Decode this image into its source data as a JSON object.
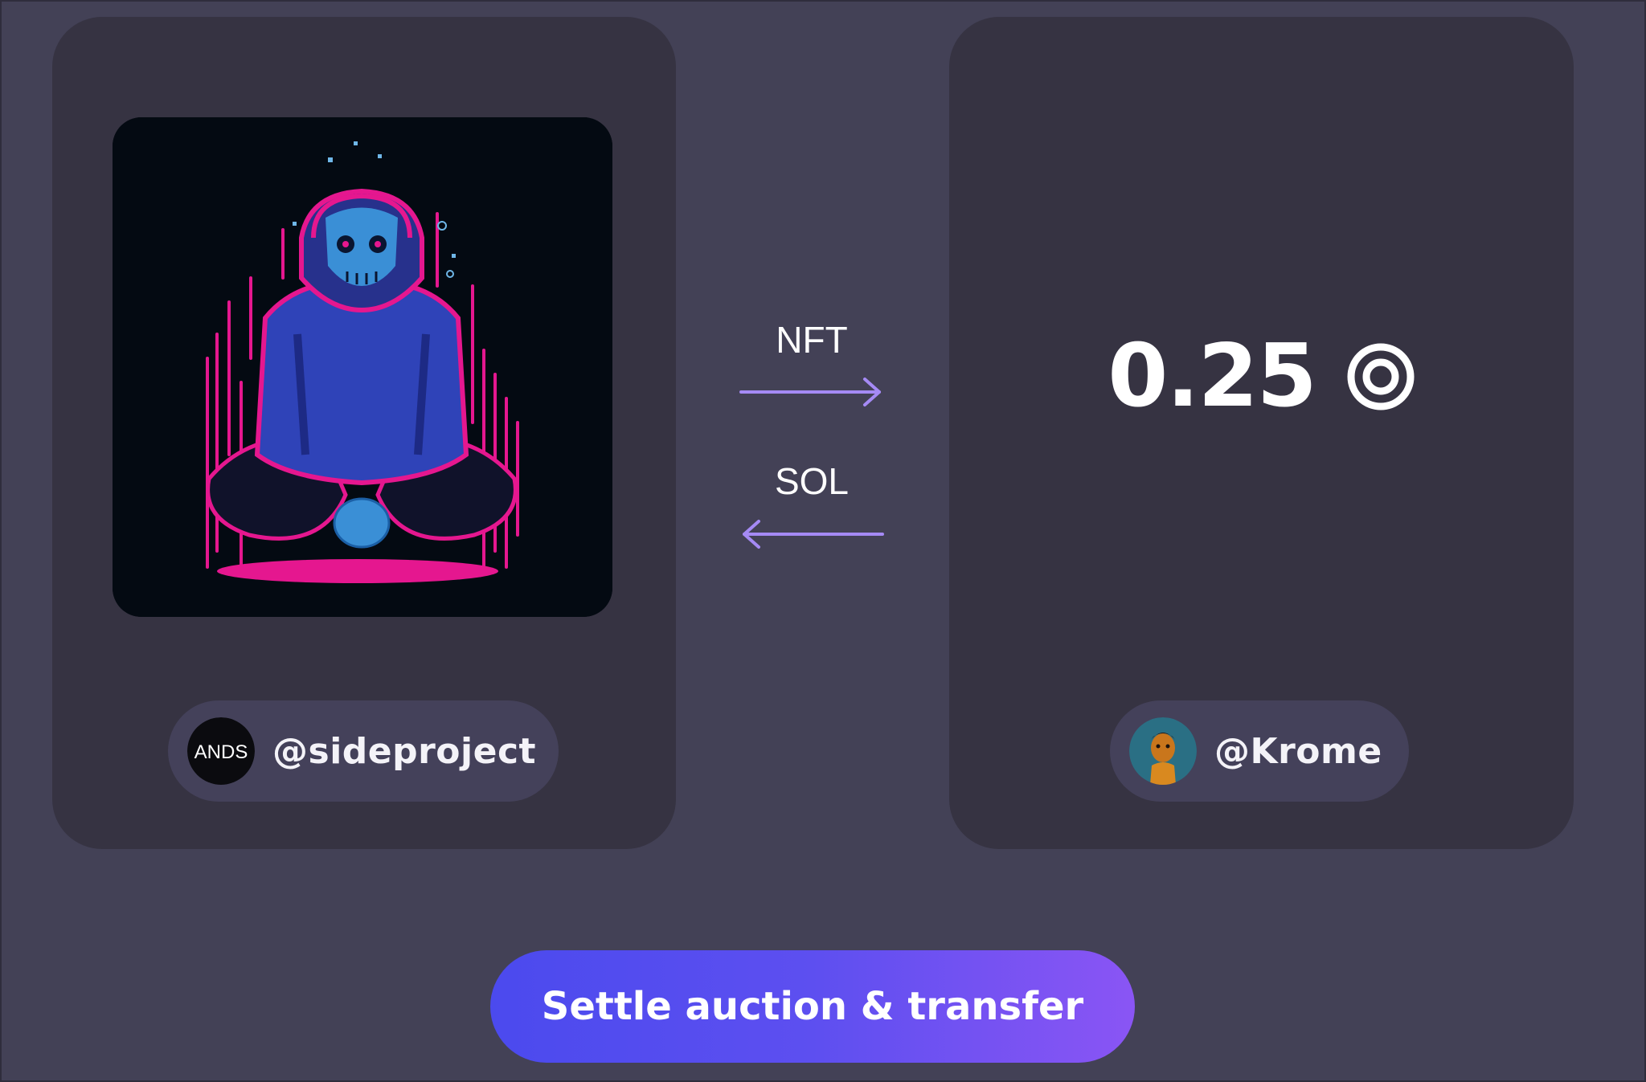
{
  "seller": {
    "username": "@sideproject",
    "avatar_text": "ANDS"
  },
  "buyer": {
    "username": "@Krome"
  },
  "swap": {
    "to_buyer_label": "NFT",
    "to_seller_label": "SOL"
  },
  "price": {
    "amount": "0.25",
    "currency_icon": "sol-currency-icon"
  },
  "actions": {
    "settle_label": "Settle auction & transfer"
  },
  "colors": {
    "background": "#434156",
    "card": "#363342",
    "pill": "#44415a",
    "arrow": "#a58af5",
    "button_gradient_start": "#4b4aee",
    "button_gradient_end": "#8a55f4"
  }
}
